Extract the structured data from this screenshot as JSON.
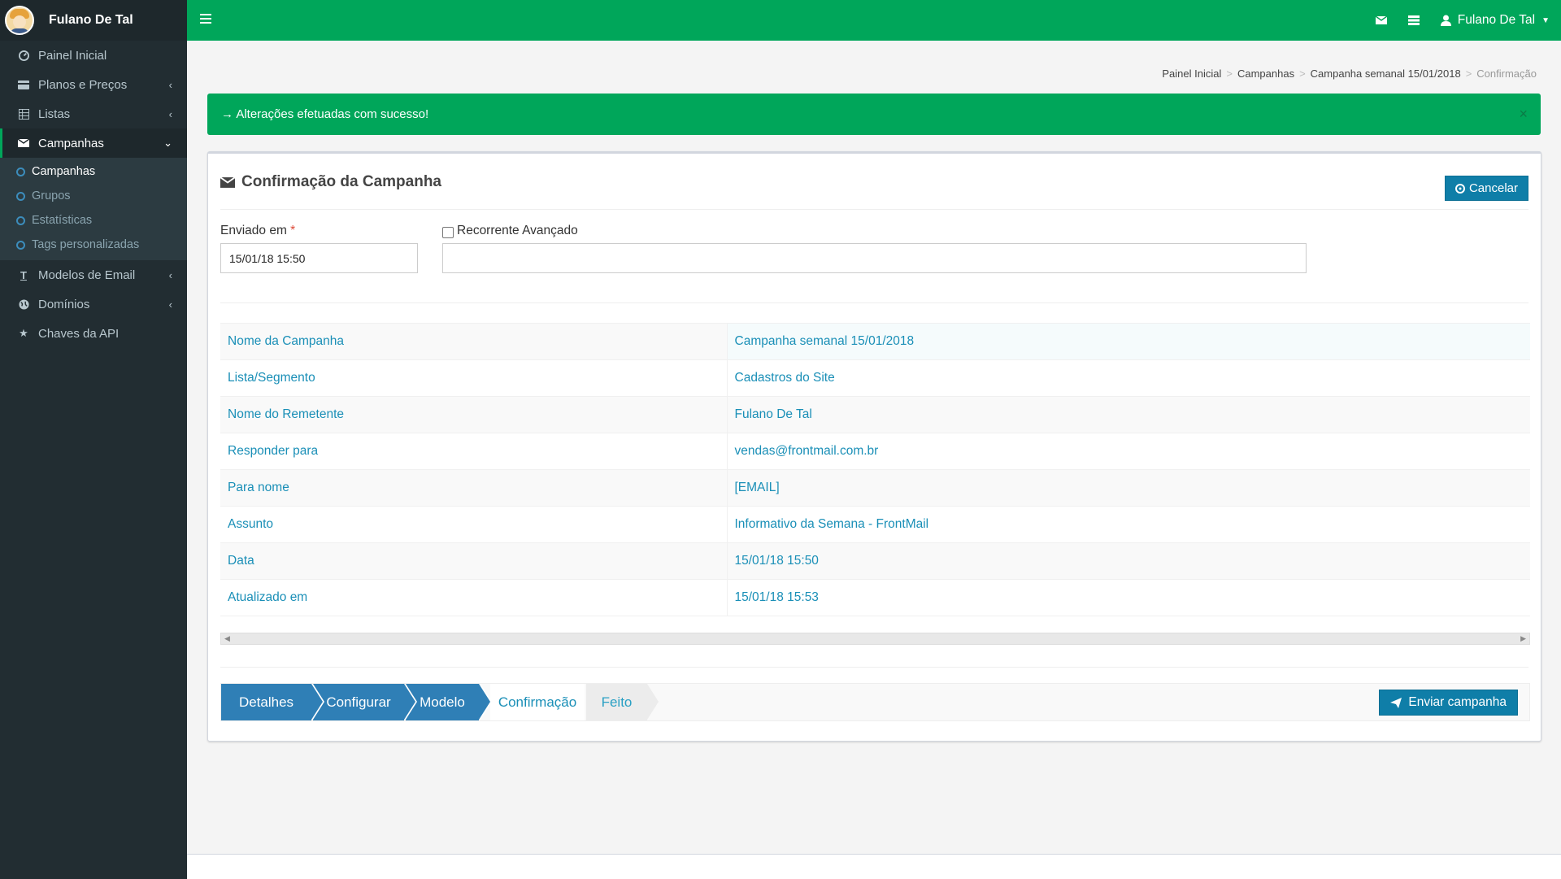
{
  "brand": {
    "user_name": "Fulano De Tal"
  },
  "sidebar": {
    "items": [
      {
        "label": "Painel Inicial"
      },
      {
        "label": "Planos e Preços"
      },
      {
        "label": "Listas"
      },
      {
        "label": "Campanhas"
      },
      {
        "label": "Modelos de Email"
      },
      {
        "label": "Domínios"
      },
      {
        "label": "Chaves da API"
      }
    ],
    "sub_items": [
      {
        "label": "Campanhas"
      },
      {
        "label": "Grupos"
      },
      {
        "label": "Estatísticas"
      },
      {
        "label": "Tags personalizadas"
      }
    ]
  },
  "topbar": {
    "user_name": "Fulano De Tal"
  },
  "breadcrumb": [
    "Painel Inicial",
    "Campanhas",
    "Campanha semanal 15/01/2018",
    "Confirmação"
  ],
  "alert": {
    "text": "→ Alterações efetuadas com sucesso!",
    "close": "×"
  },
  "box": {
    "title": "Confirmação da Campanha",
    "cancel_label": "Cancelar",
    "sent_label": "Enviado em",
    "required_mark": "*",
    "sent_value": "15/01/18 15:50",
    "recurrent_label": "Recorrente Avançado"
  },
  "details": [
    {
      "key": "Nome da Campanha",
      "value": "Campanha semanal 15/01/2018"
    },
    {
      "key": "Lista/Segmento",
      "value": "Cadastros do Site"
    },
    {
      "key": "Nome do Remetente",
      "value": "Fulano De Tal"
    },
    {
      "key": "Responder para",
      "value": "vendas@frontmail.com.br"
    },
    {
      "key": "Para nome",
      "value": "[EMAIL]"
    },
    {
      "key": "Assunto",
      "value": "Informativo da Semana - FrontMail"
    },
    {
      "key": "Data",
      "value": "15/01/18 15:50"
    },
    {
      "key": "Atualizado em",
      "value": "15/01/18 15:53"
    }
  ],
  "wizard": {
    "steps": [
      {
        "label": "Detalhes"
      },
      {
        "label": "Configurar"
      },
      {
        "label": "Modelo"
      },
      {
        "label": "Confirmação"
      },
      {
        "label": "Feito"
      }
    ],
    "send_label": "Enviar campanha"
  },
  "colors": {
    "primary_green": "#00a65a",
    "sidebar_bg": "#222d32",
    "link_blue": "#1a8fb7",
    "button_blue": "#0f7ea8",
    "step_blue": "#2f7fb6"
  }
}
